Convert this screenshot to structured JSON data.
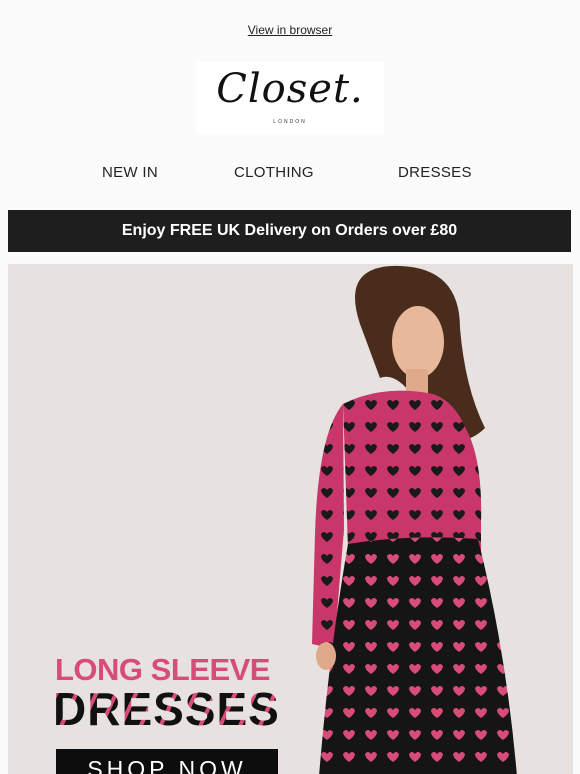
{
  "header": {
    "view_in_browser": "View in browser"
  },
  "logo": {
    "wordmark": "Closet.",
    "subtitle": "LONDON"
  },
  "nav": {
    "items": [
      "NEW IN",
      "CLOTHING",
      "DRESSES"
    ]
  },
  "banner": {
    "text": "Enjoy FREE UK Delivery on Orders over £80"
  },
  "hero": {
    "headline_line1": "LONG SLEEVE",
    "headline_line2": "DRESSES",
    "cta_label": "SHOP NOW",
    "colors": {
      "pink": "#d84c78",
      "background": "#e7e2df",
      "dark": "#111111"
    }
  }
}
